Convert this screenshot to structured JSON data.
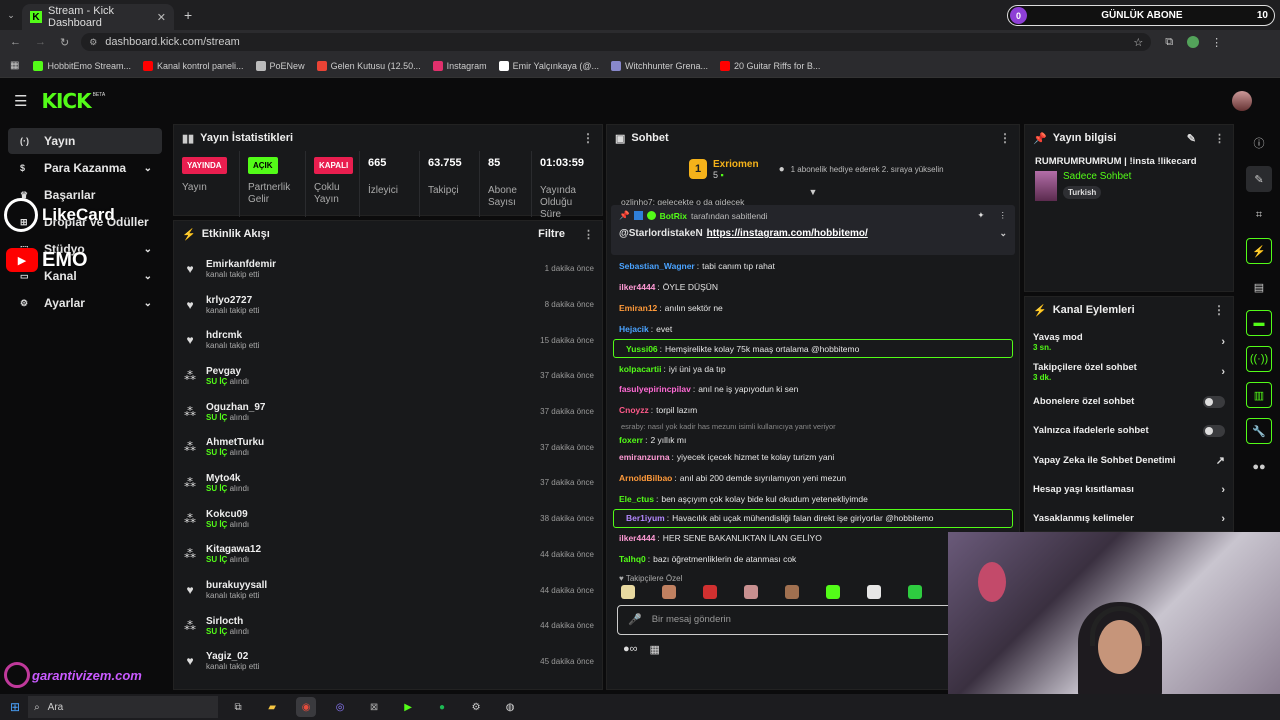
{
  "browser": {
    "tab_title": "Stream - Kick Dashboard",
    "url": "dashboard.kick.com/stream",
    "bookmarks": [
      {
        "label": "HobbitEmo Stream...",
        "color": "#53fc18"
      },
      {
        "label": "Kanal kontrol paneli...",
        "color": "#ff0000"
      },
      {
        "label": "PoENew",
        "color": "#bbbbbb"
      },
      {
        "label": "Gelen Kutusu (12.50...",
        "color": "#ea4335"
      },
      {
        "label": "Instagram",
        "color": "#e1306c"
      },
      {
        "label": "Emir Yalçınkaya (@...",
        "color": "#ffffff"
      },
      {
        "label": "Witchhunter Grena...",
        "color": "#8888cc"
      },
      {
        "label": "20 Guitar Riffs for B...",
        "color": "#ff0000"
      }
    ],
    "sub_goal": {
      "count": "0",
      "label": "GÜNLÜK ABONE",
      "target": "10"
    }
  },
  "app": {
    "logo": "KICK",
    "beta": "BETA"
  },
  "nav": [
    {
      "label": "Yayın",
      "icon": "broadcast-icon"
    },
    {
      "label": "Para Kazanma",
      "icon": "money-icon"
    },
    {
      "label": "Başarılar",
      "icon": "trophy-icon"
    },
    {
      "label": "Droplar ve Ödüller",
      "icon": "gift-icon"
    },
    {
      "label": "Stüdyo",
      "icon": "studio-icon"
    },
    {
      "label": "Kanal",
      "icon": "channel-icon"
    },
    {
      "label": "Ayarlar",
      "icon": "gear-icon"
    }
  ],
  "overlays": {
    "likecard": "LikeCard",
    "emo": "EMO",
    "garanti": "garantivizem.com"
  },
  "stats": {
    "title": "Yayın İstatistikleri",
    "items": [
      {
        "badge": "YAYINDA",
        "badge_color": "#e91e4f",
        "label": "Yayın"
      },
      {
        "badge": "AÇIK",
        "badge_color": "#53fc18",
        "label": "Partnerlik Gelir"
      },
      {
        "badge": "KAPALI",
        "badge_color": "#e91e4f",
        "label": "Çoklu Yayın"
      },
      {
        "value": "665",
        "label": "İzleyici"
      },
      {
        "value": "63.755",
        "label": "Takipçi"
      },
      {
        "value": "85",
        "label": "Abone Sayısı"
      },
      {
        "value": "01:03:59",
        "label": "Yayında Olduğu Süre"
      }
    ]
  },
  "activity": {
    "title": "Etkinlik Akışı",
    "filter": "Filtre",
    "events": [
      {
        "name": "Emirkanfdemir",
        "sub": "kanalı takip etti",
        "time": "1 dakika önce",
        "type": "follow"
      },
      {
        "name": "krlyo2727",
        "sub": "kanalı takip etti",
        "time": "8 dakika önce",
        "type": "follow"
      },
      {
        "name": "hdrcmk",
        "sub": "kanalı takip etti",
        "time": "15 dakika önce",
        "type": "follow"
      },
      {
        "name": "Pevgay",
        "hl": "SU İÇ",
        "sub": " alındı",
        "time": "37 dakika önce",
        "type": "reward"
      },
      {
        "name": "Oguzhan_97",
        "hl": "SU İÇ",
        "sub": " alındı",
        "time": "37 dakika önce",
        "type": "reward"
      },
      {
        "name": "AhmetTurku",
        "hl": "SU İÇ",
        "sub": " alındı",
        "time": "37 dakika önce",
        "type": "reward"
      },
      {
        "name": "Myto4k",
        "hl": "SU İÇ",
        "sub": " alındı",
        "time": "37 dakika önce",
        "type": "reward"
      },
      {
        "name": "Kokcu09",
        "hl": "SU İÇ",
        "sub": " alındı",
        "time": "38 dakika önce",
        "type": "reward"
      },
      {
        "name": "Kitagawa12",
        "hl": "SU İÇ",
        "sub": " alındı",
        "time": "44 dakika önce",
        "type": "reward"
      },
      {
        "name": "burakuyysall",
        "sub": "kanalı takip etti",
        "time": "44 dakika önce",
        "type": "follow"
      },
      {
        "name": "Sirlocth",
        "hl": "SU İÇ",
        "sub": " alındı",
        "time": "44 dakika önce",
        "type": "reward"
      },
      {
        "name": "Yagiz_02",
        "sub": "kanalı takip etti",
        "time": "45 dakika önce",
        "type": "follow"
      }
    ]
  },
  "chat": {
    "title": "Sohbet",
    "leader": {
      "rank": "1",
      "name": "Exriomen",
      "count": "5",
      "info": "1 abonelik hediye ederek 2. sıraya yükselin"
    },
    "partial": "ozlinho7: gelecekte o da gidecek",
    "pinned": {
      "by": "BotRix",
      "by_suffix": "tarafından sabitlendi",
      "text": "@StarlordistakeN",
      "link": "https://instagram.com/hobbitemo/"
    },
    "messages": [
      {
        "user": "Sebastian_Wagner",
        "color": "#4aa3ff",
        "text": "tabi canım tıp rahat"
      },
      {
        "user": "ilker4444",
        "color": "#ff9ad5",
        "text": "ÖYLE DÜŞÜN"
      },
      {
        "user": "Emiran12",
        "color": "#ff9a3a",
        "text": "anılın sektör ne"
      },
      {
        "user": "Hejacik",
        "color": "#4aa3ff",
        "text": "evet"
      },
      {
        "user": "Yussi06",
        "color": "#53fc18",
        "text": "Hemşirelikte kolay 75k maaş ortalama @hobbitemo",
        "hl": true
      },
      {
        "user": "kolpacartii",
        "color": "#53fc18",
        "text": "iyi üni ya da tıp"
      },
      {
        "user": "fasulyepirincpilav",
        "color": "#ff6ad5",
        "text": "anıl ne iş yapıyodun ki sen"
      },
      {
        "user": "Cnoyzz",
        "color": "#ff5a8a",
        "text": "torpil lazım"
      },
      {
        "user": "foxerr",
        "color": "#53fc18",
        "text": "2 yıllık mı",
        "reply": "esraby: nasıl yok kadir has mezunı isimli kullanıcıya yanıt veriyor"
      },
      {
        "user": "emiranzurna",
        "color": "#ff9ad5",
        "text": "yiyecek içecek hizmet te kolay turizm yani"
      },
      {
        "user": "ArnoldBilbao",
        "color": "#ff9a3a",
        "text": "anıl abi 200 demde sıyrılamıyon yeni mezun"
      },
      {
        "user": "Ele_ctus",
        "color": "#53fc18",
        "text": "ben aşçıyım çok kolay bide kul okudum yetenekliyimde"
      },
      {
        "user": "Ber1iyum",
        "color": "#b388ff",
        "text": "Havacılık abi uçak mühendisliği falan direkt işe giriyorlar @hobbitemo",
        "hl": true
      },
      {
        "user": "ilker4444",
        "color": "#ff9ad5",
        "text": "HER SENE BAKANLIKTAN İLAN GELİYO"
      },
      {
        "user": "Talhq0",
        "color": "#53fc18",
        "text": "bazı öğretmenliklerin de atanması cok"
      }
    ],
    "followers_only": "Takipçilere Özel",
    "placeholder": "Bir mesaj gönderin"
  },
  "stream_info": {
    "title": "Yayın bilgisi",
    "stream_title": "RUMRUMRUMRUM | !insta !likecard",
    "chat_mode": "Sadece Sohbet",
    "language": "Turkish"
  },
  "channel_actions": {
    "title": "Kanal Eylemleri",
    "items": [
      {
        "label": "Yavaş mod",
        "sub": "3 sn.",
        "control": "chevron"
      },
      {
        "label": "Takipçilere özel sohbet",
        "sub": "3 dk.",
        "control": "chevron"
      },
      {
        "label": "Abonelere özel sohbet",
        "control": "toggle"
      },
      {
        "label": "Yalnızca ifadelerle sohbet",
        "control": "toggle"
      },
      {
        "label": "Yapay Zeka ile Sohbet Denetimi",
        "control": "external"
      },
      {
        "label": "Hesap yaşı kısıtlaması",
        "control": "chevron"
      },
      {
        "label": "Yasaklanmış kelimeler",
        "control": "chevron"
      }
    ]
  },
  "taskbar": {
    "search": "Ara"
  }
}
